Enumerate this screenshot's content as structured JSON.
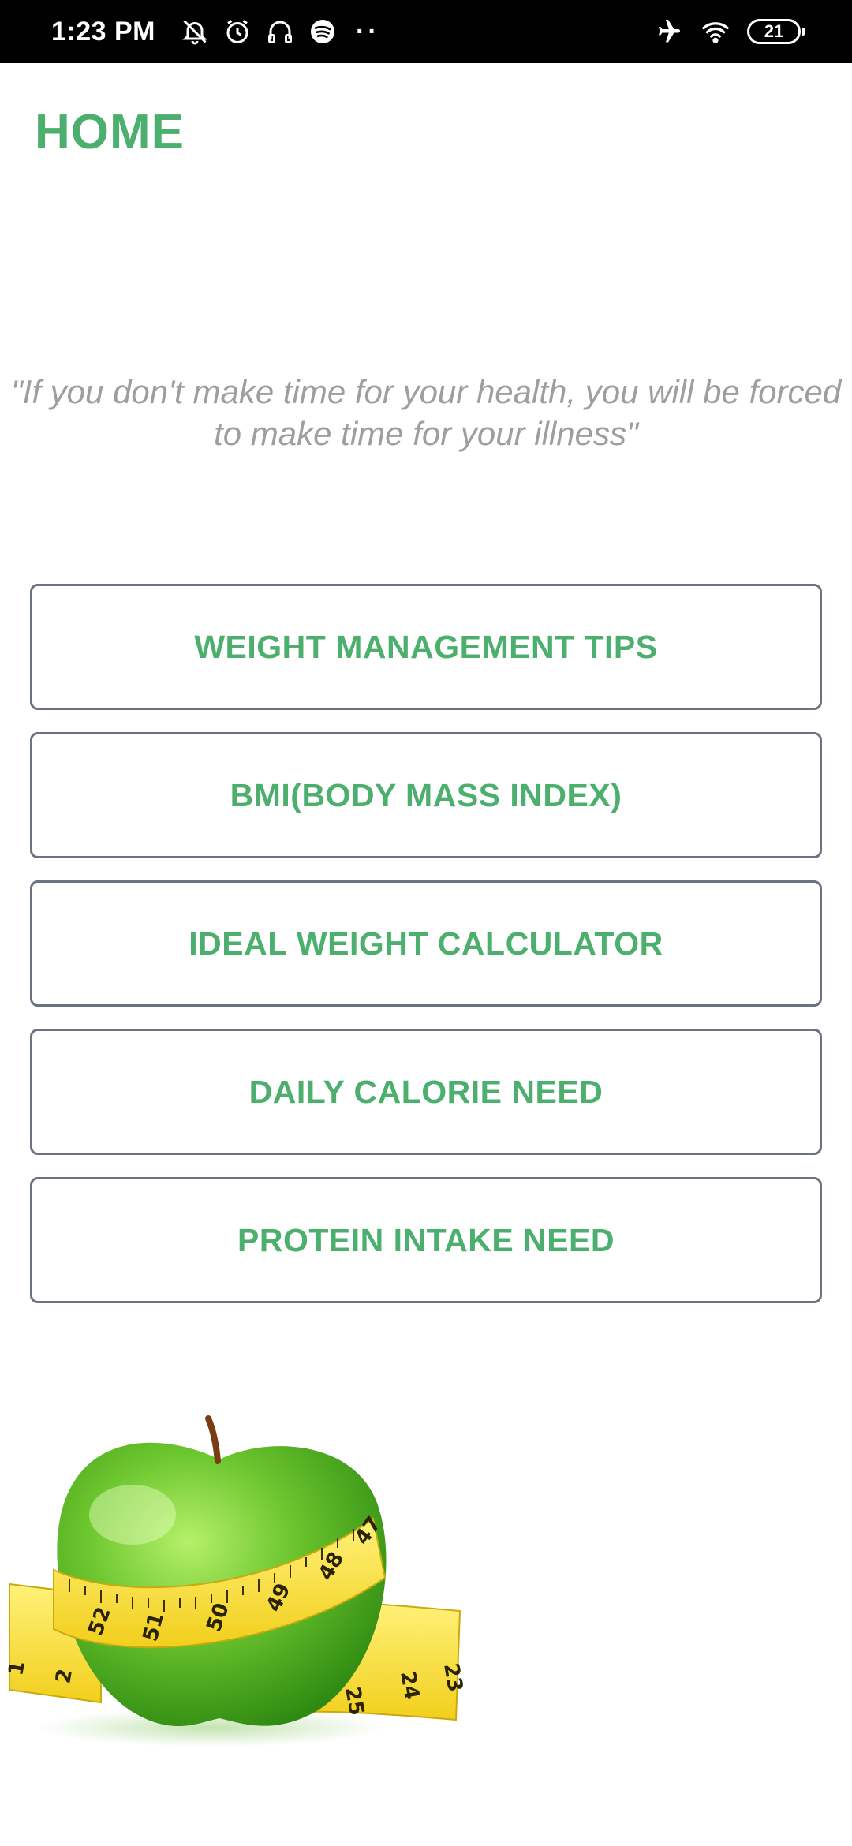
{
  "status_bar": {
    "time": "1:23 PM",
    "dots": "··",
    "battery": "21",
    "left_icons": [
      "bell-muted-icon",
      "alarm-icon",
      "headphones-icon",
      "spotify-icon"
    ],
    "right_icons": [
      "airplane-icon",
      "wifi-icon",
      "battery-icon"
    ]
  },
  "page": {
    "title": "HOME",
    "quote_line1": "\"If you don't make time for your health, you will be forced",
    "quote_line2": "to make time for your illness\""
  },
  "menu": {
    "items": [
      {
        "label": "WEIGHT MANAGEMENT TIPS"
      },
      {
        "label": "BMI(BODY MASS INDEX)"
      },
      {
        "label": "IDEAL WEIGHT CALCULATOR"
      },
      {
        "label": "DAILY CALORIE NEED"
      },
      {
        "label": "PROTEIN INTAKE NEED"
      }
    ]
  },
  "illustration": {
    "tape_numbers": [
      "1",
      "2",
      "52",
      "51",
      "50",
      "49",
      "48",
      "47",
      "25",
      "24",
      "23"
    ]
  },
  "colors": {
    "accent": "#4caf6e",
    "quote_text": "#9e9e9e",
    "button_border": "#6b7280",
    "status_bar_bg": "#000000"
  }
}
